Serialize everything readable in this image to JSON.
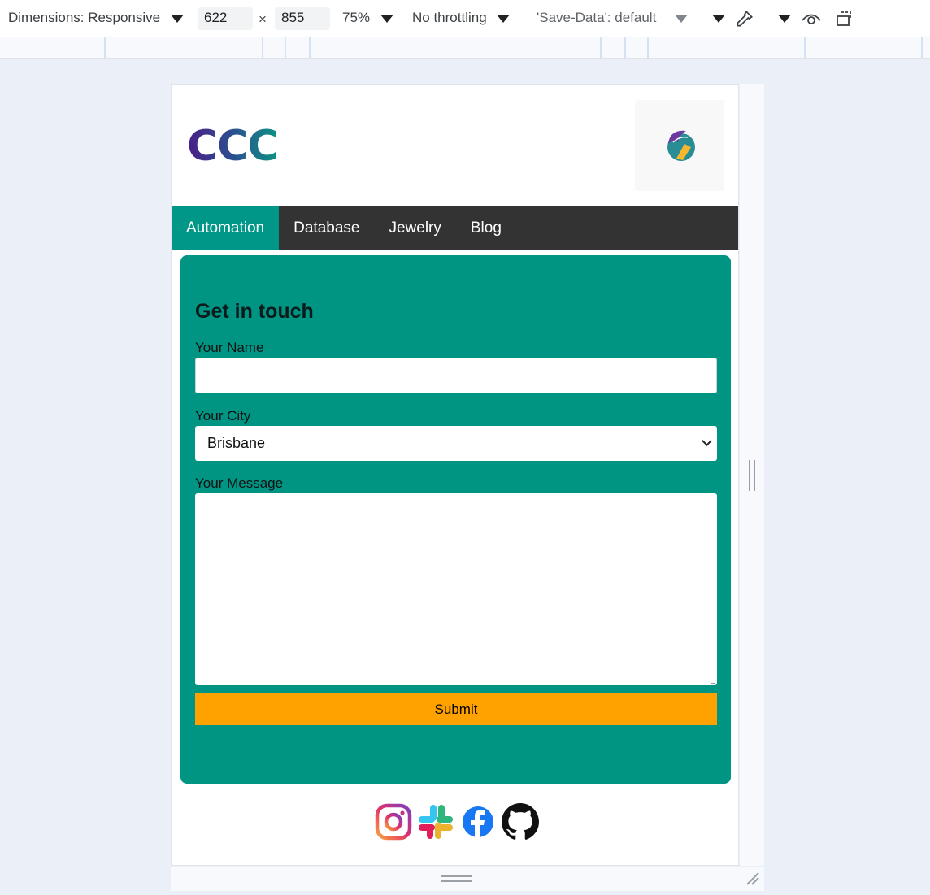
{
  "devtools": {
    "dimensions_label": "Dimensions: Responsive",
    "width": "622",
    "times": "×",
    "height": "855",
    "zoom": "75%",
    "throttling": "No throttling",
    "save_data": "'Save-Data': default"
  },
  "site": {
    "logo_text": "CCC",
    "nav": {
      "items": [
        {
          "label": "Automation",
          "active": true
        },
        {
          "label": "Database",
          "active": false
        },
        {
          "label": "Jewelry",
          "active": false
        },
        {
          "label": "Blog",
          "active": false
        }
      ]
    },
    "form": {
      "heading": "Get in touch",
      "name_label": "Your Name",
      "name_value": "",
      "city_label": "Your City",
      "city_selected": "Brisbane",
      "message_label": "Your Message",
      "message_value": "",
      "submit_label": "Submit"
    },
    "socials": [
      "instagram-icon",
      "slack-icon",
      "facebook-icon",
      "github-icon"
    ],
    "colors": {
      "nav_bg": "#333333",
      "accent": "#009688",
      "card_bg": "#009483",
      "submit_bg": "#ffa200"
    }
  }
}
